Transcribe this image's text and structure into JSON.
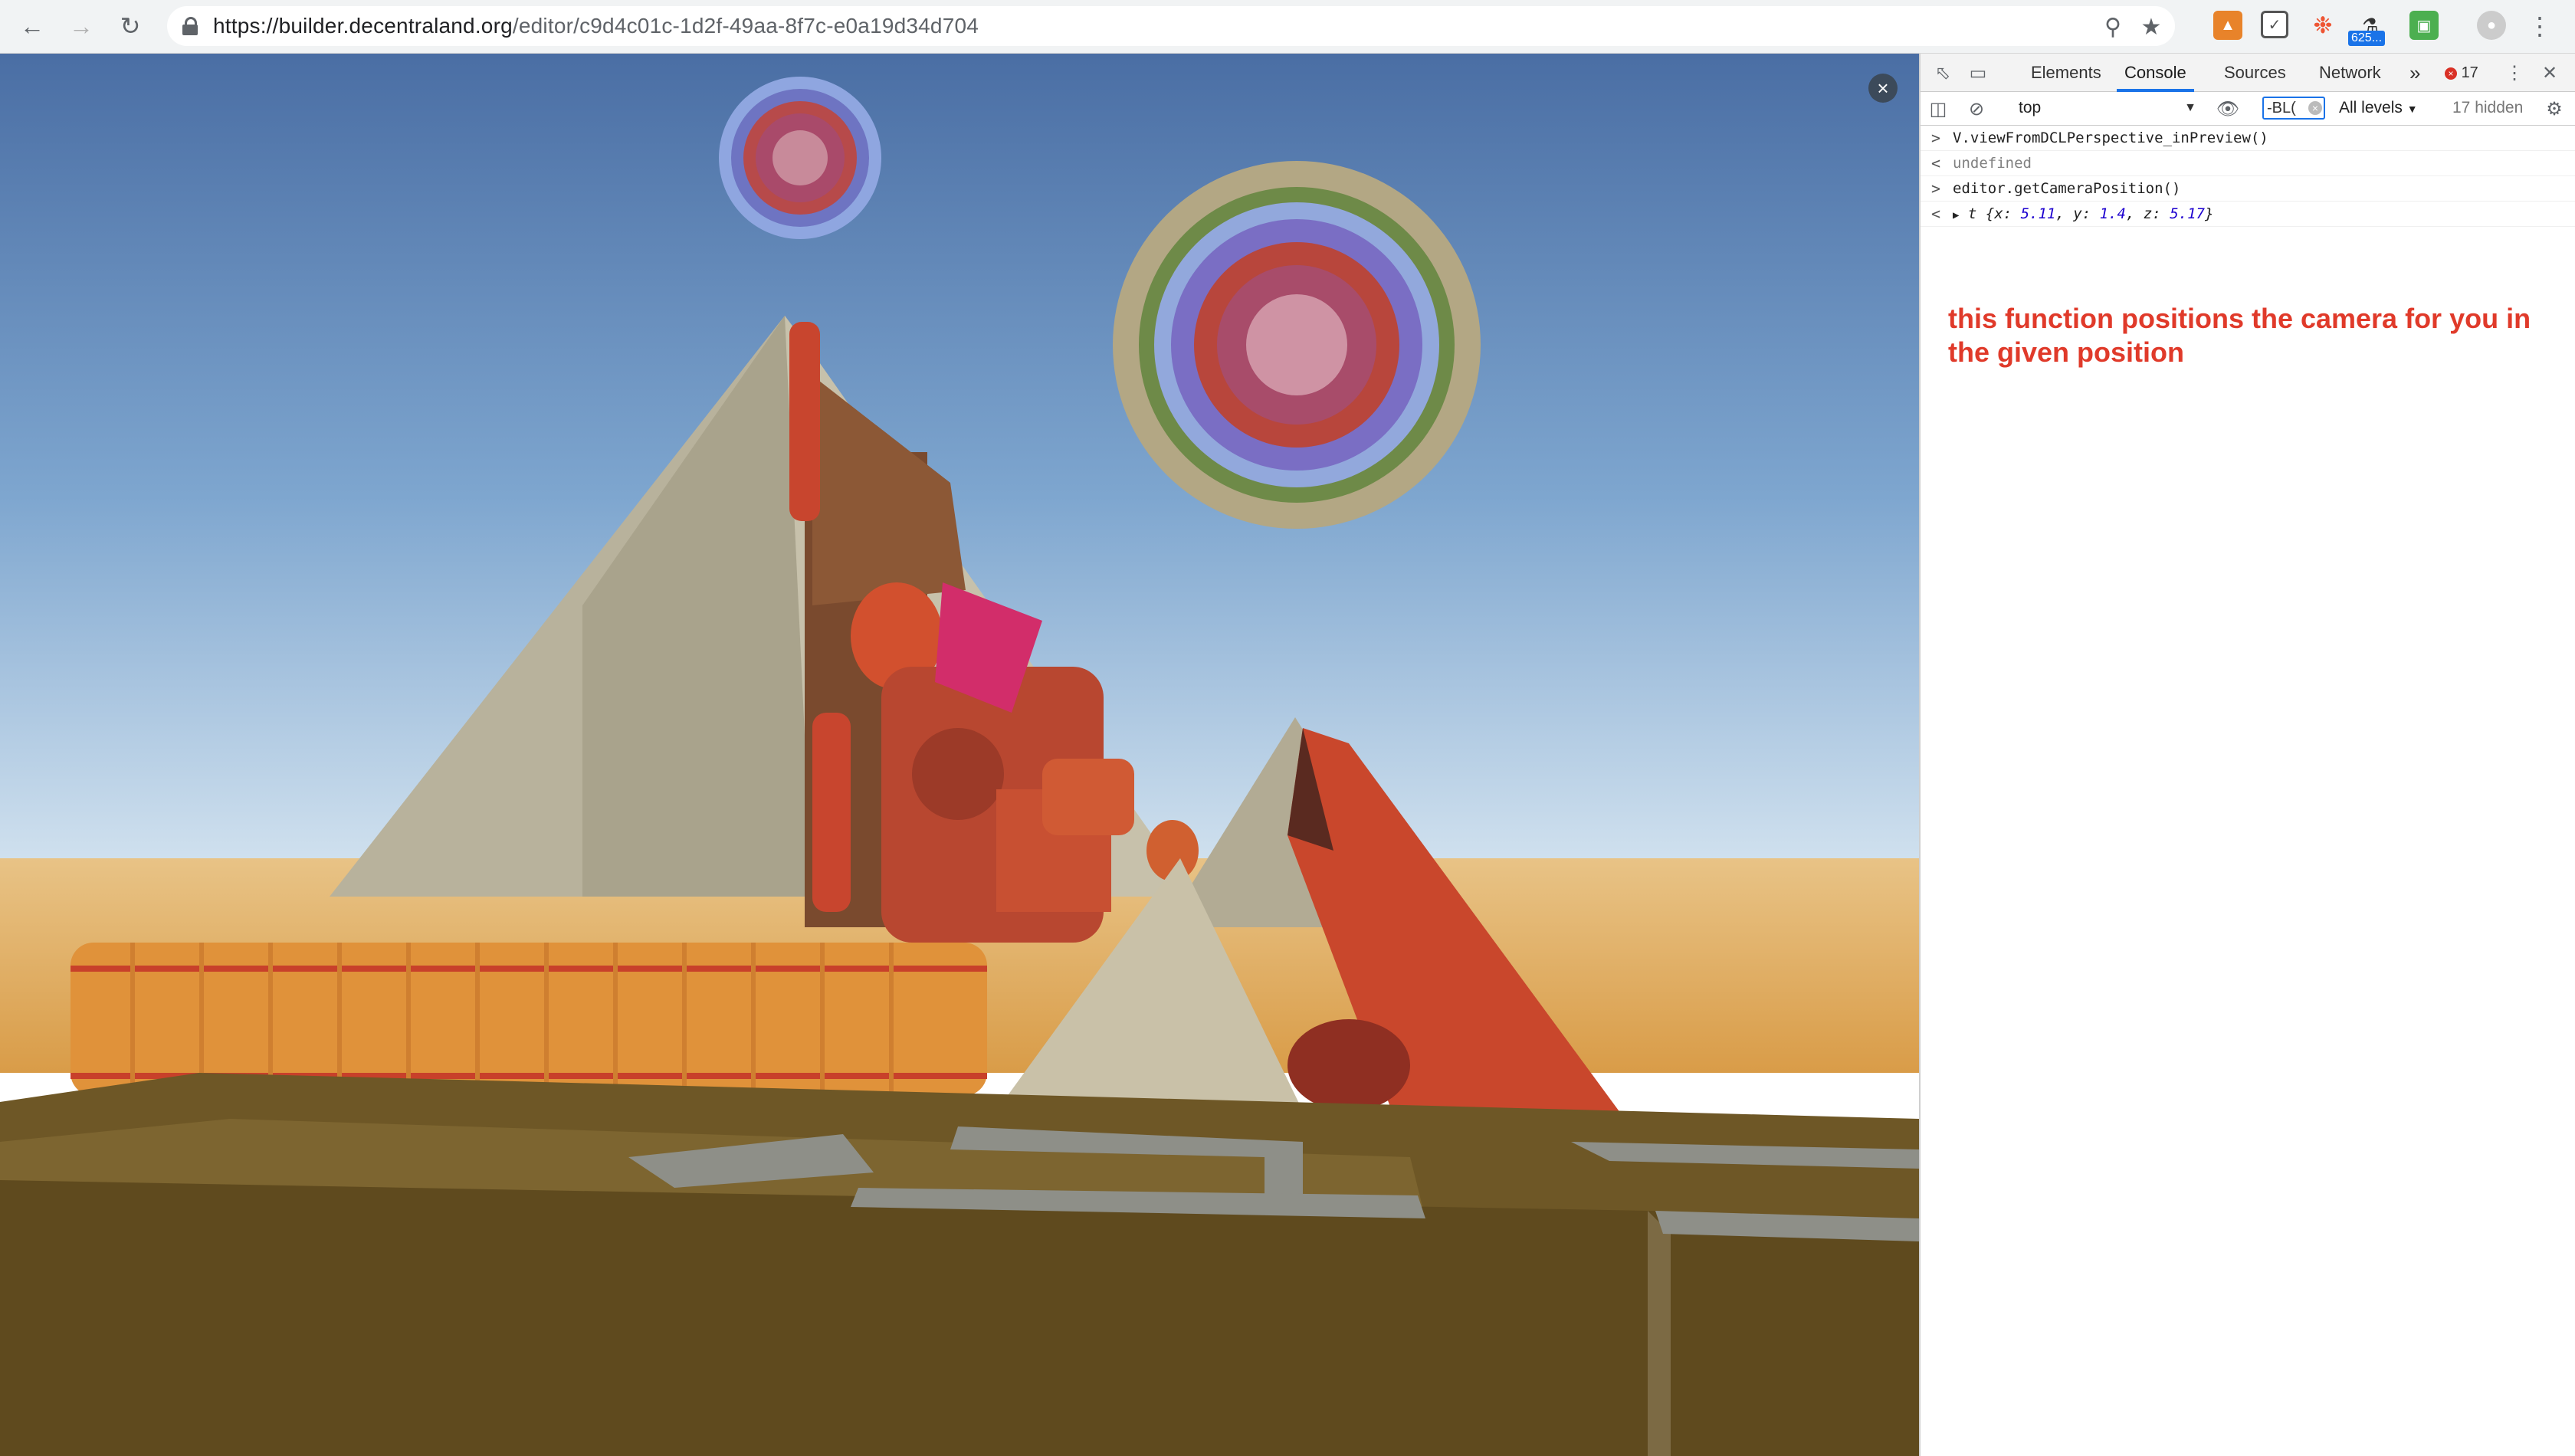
{
  "browser": {
    "url_host": "https://builder.decentraland.org",
    "url_path": "/editor/c9d4c01c-1d2f-49aa-8f7c-e0a19d34d704",
    "extension_badge": "625..."
  },
  "devtools": {
    "tabs": [
      "Elements",
      "Console",
      "Sources",
      "Network"
    ],
    "more_tabs": "»",
    "error_count": "17",
    "context": "top",
    "filter_value": "-BL(",
    "levels": "All levels",
    "hidden": "17 hidden",
    "console_lines": [
      {
        "prompt": ">",
        "text": "V.viewFromDCLPerspective_inPreview()",
        "type": "input"
      },
      {
        "prompt": "<",
        "text": "undefined",
        "type": "result"
      },
      {
        "prompt": ">",
        "text": "editor.getCameraPosition()",
        "type": "input"
      }
    ],
    "object_result": {
      "prefix": "t",
      "x_key": "x:",
      "x_val": "5.11",
      "y_key": "y:",
      "y_val": "1.4",
      "z_key": "z:",
      "z_val": "5.17"
    },
    "annotation": "this function positions the camera for you in the given position"
  },
  "colors": {
    "sky_top": "#4a72a8",
    "sand": "#e6b060",
    "accent": "#1a73e8",
    "annotation": "#e03a2a"
  }
}
